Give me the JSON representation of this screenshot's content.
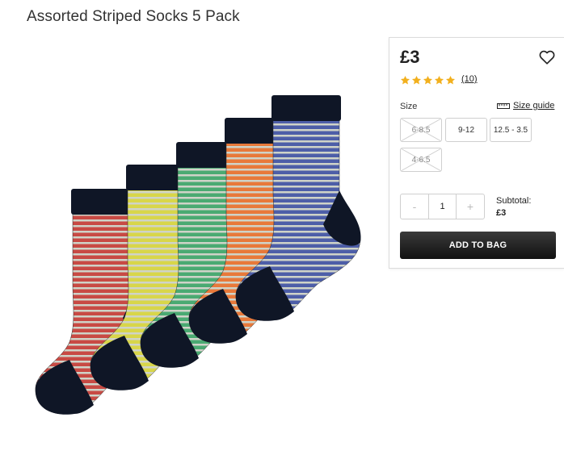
{
  "product": {
    "title": "Assorted Striped Socks 5 Pack",
    "image_icon": "striped-socks-image"
  },
  "purchase": {
    "price": "£3",
    "rating": 5,
    "rating_max": 5,
    "review_count": "(10)",
    "size_label": "Size",
    "size_guide_label": "Size guide",
    "sizes": [
      {
        "label": "6-8.5",
        "available": false
      },
      {
        "label": "9-12",
        "available": true
      },
      {
        "label": "12.5 - 3.5",
        "available": true
      },
      {
        "label": "4-6.5",
        "available": false
      }
    ],
    "quantity": {
      "minus": "-",
      "value": "1",
      "plus": "+"
    },
    "subtotal_label": "Subtotal:",
    "subtotal_value": "£3",
    "add_to_bag_label": "ADD TO BAG"
  },
  "colors": {
    "star": "#f2b01e",
    "button": "#1a1a1a",
    "sock_colors": [
      "#4d5ea8",
      "#e8793a",
      "#4aaa72",
      "#d8d64a",
      "#c84a44"
    ],
    "sock_trim": "#0f1626"
  }
}
